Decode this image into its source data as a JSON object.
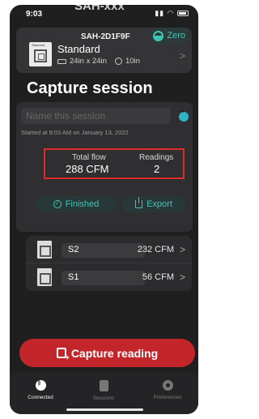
{
  "status_bar": {
    "time": "9:03",
    "partial_title": "SAH-xxx"
  },
  "device": {
    "id": "SAH-2D1F9F",
    "zero_label": "Zero",
    "icon_label": "Standard",
    "type": "Standard",
    "dimensions": "24in x 24in",
    "depth": "10in"
  },
  "session": {
    "title": "Capture session",
    "name_placeholder": "Name this session",
    "started": "Started at 9:03 AM on January 13, 2022",
    "total_flow_label": "Total flow",
    "total_flow_value": "288 CFM",
    "readings_label": "Readings",
    "readings_value": "2",
    "finished_label": "Finished",
    "export_label": "Export"
  },
  "readings": [
    {
      "name": "S2",
      "flow": "232 CFM"
    },
    {
      "name": "S1",
      "flow": "56 CFM"
    }
  ],
  "capture_button": "Capture reading",
  "tabs": [
    {
      "label": "Connected",
      "active": true
    },
    {
      "label": "Sessions",
      "active": false
    },
    {
      "label": "Preferences",
      "active": false
    }
  ],
  "colors": {
    "accent": "#3fc7b6",
    "primary_button": "#c2262b",
    "highlight_box": "#e12a2a",
    "background": "#1f1f20"
  }
}
